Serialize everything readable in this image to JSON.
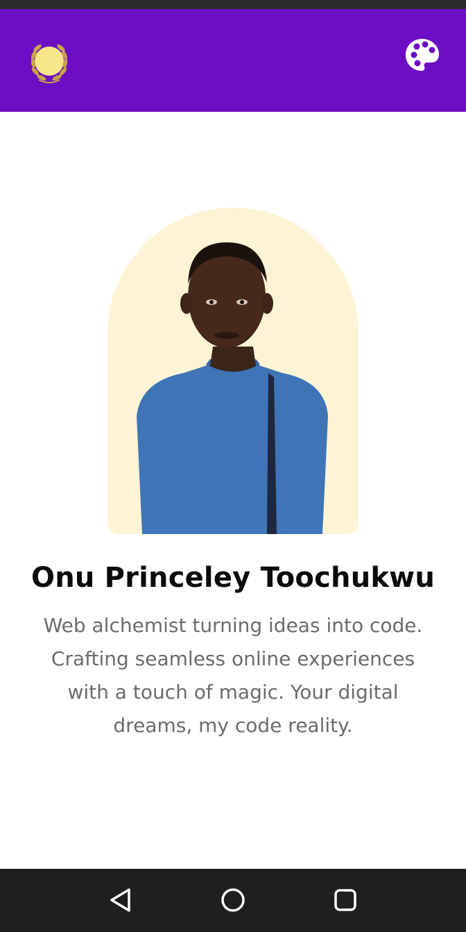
{
  "header": {
    "logo_icon": "laurel-sun-logo-icon",
    "palette_icon": "palette-icon",
    "accent_color": "#6c0fc4"
  },
  "profile": {
    "photo": "portrait-photo",
    "name": "Onu Princeley Toochukwu",
    "bio_lines": [
      "Web alchemist turning ideas into code.",
      "Crafting seamless online experiences",
      "with a touch of magic. Your digital",
      "dreams, my code reality."
    ]
  },
  "navigation": {
    "back_icon": "back-triangle-icon",
    "home_icon": "home-circle-icon",
    "recents_icon": "recents-square-icon"
  }
}
